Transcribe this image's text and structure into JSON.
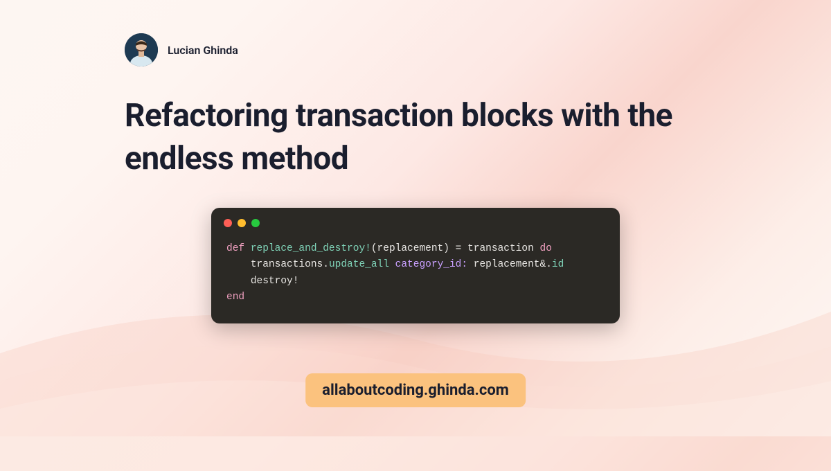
{
  "author": {
    "name": "Lucian Ghinda"
  },
  "title": "Refactoring transaction blocks with the endless method",
  "code": {
    "line1": {
      "kw_def": "def",
      "method": "replace_and_destroy!",
      "open_paren": "(",
      "param": "replacement",
      "close_paren": ")",
      "eq": " = ",
      "transaction": "transaction",
      "kw_do": "do"
    },
    "line2": {
      "indent": "    ",
      "receiver": "transactions",
      "dot": ".",
      "method": "update_all",
      "symbol": "category_id:",
      "space": " ",
      "arg1": "replacement",
      "safe_nav": "&.",
      "attr": "id"
    },
    "line3": {
      "indent": "    ",
      "call": "destroy!"
    },
    "line4": {
      "kw_end": "end"
    }
  },
  "domain": "allaboutcoding.ghinda.com"
}
